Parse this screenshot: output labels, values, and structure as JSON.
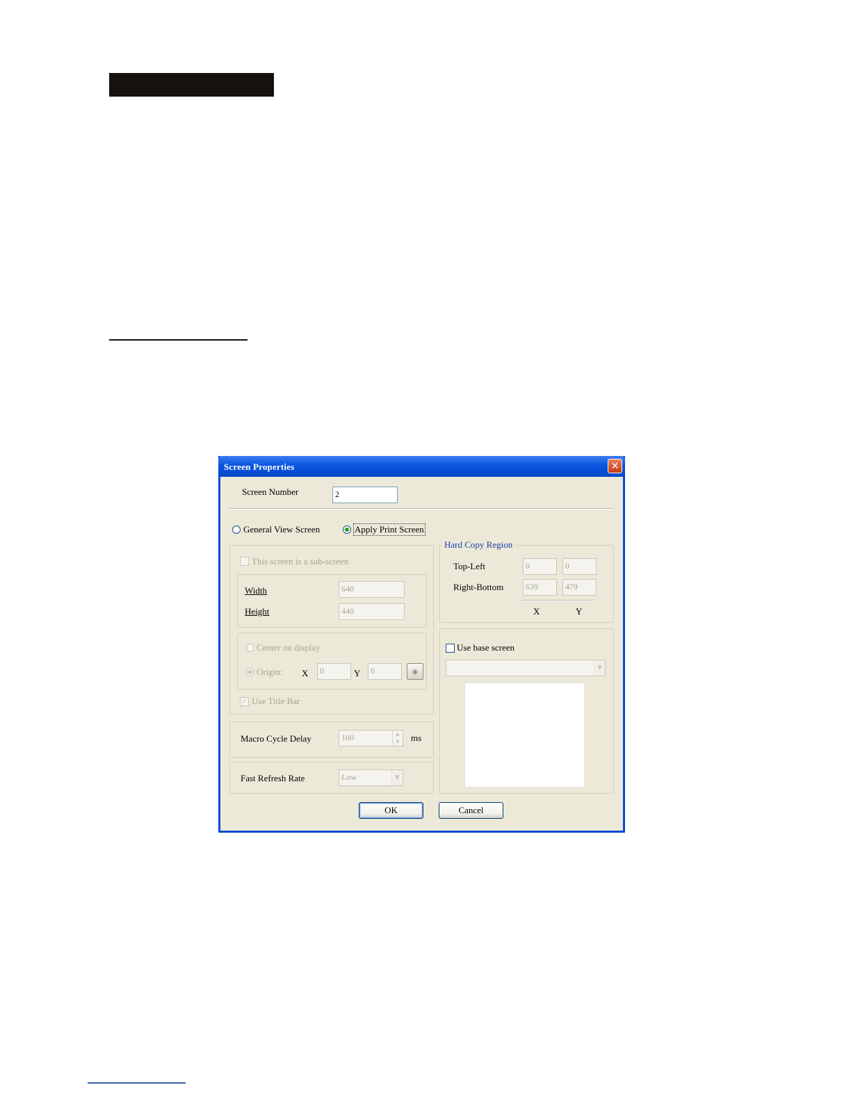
{
  "dialog": {
    "title": "Screen Properties",
    "screen_number_label": "Screen Number",
    "screen_number_value": "2",
    "radio_general": "General View Screen",
    "radio_apply": "Apply Print Screen",
    "sub_screen_label": "This screen is a sub-screen",
    "width_label": "Width",
    "width_value": "640",
    "height_label": "Height",
    "height_value": "440",
    "center_label": "Center on display",
    "origin_label": "Origin:",
    "origin_x_label": "X",
    "origin_x_value": "0",
    "origin_y_label": "Y",
    "origin_y_value": "0",
    "use_title_bar_label": "Use Title Bar",
    "macro_label": "Macro Cycle Delay",
    "macro_value": "100",
    "macro_unit": "ms",
    "fast_refresh_label": "Fast Refresh Rate",
    "fast_refresh_value": "Low",
    "hard_copy": {
      "legend": "Hard Copy Region",
      "top_left_label": "Top-Left",
      "top_left_x": "0",
      "top_left_y": "0",
      "right_bottom_label": "Right-Bottom",
      "right_bottom_x": "639",
      "right_bottom_y": "479",
      "col_x": "X",
      "col_y": "Y"
    },
    "use_base_screen_label": "Use base screen",
    "ok_label": "OK",
    "cancel_label": "Cancel"
  },
  "colors": {
    "titlebar": "#0a55e0",
    "dialog_bg": "#ece9d8",
    "legend_text": "#1c3fa8",
    "disabled_text": "#a6a391"
  }
}
